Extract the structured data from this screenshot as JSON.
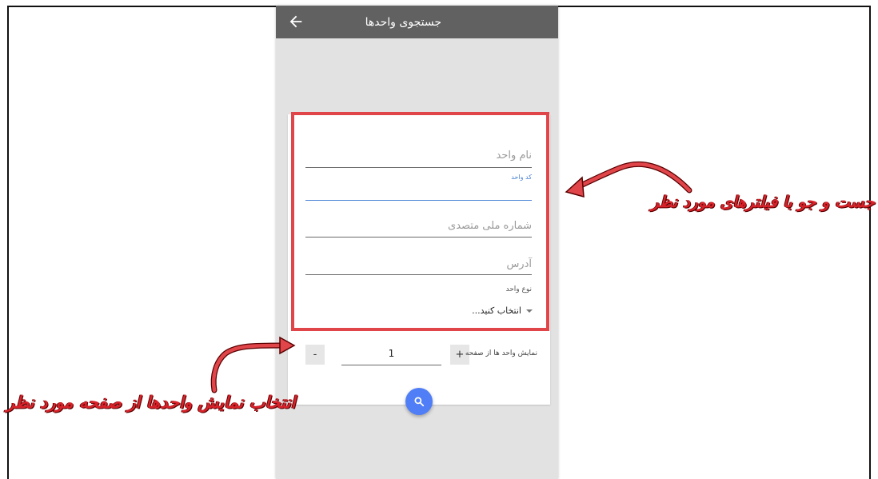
{
  "appbar": {
    "title": "جستجوی واحدها",
    "back_icon": "arrow-left-icon"
  },
  "form": {
    "unit_name_placeholder": "نام واحد",
    "unit_code_label": "کد واحد",
    "national_id_placeholder": "شماره ملی متصدی",
    "address_placeholder": "آدرس",
    "unit_type_label": "نوع واحد",
    "unit_type_selected": "انتخاب کنید..."
  },
  "pager": {
    "minus_label": "-",
    "plus_label": "+",
    "page_value": "1",
    "label": "نمایش واحد ها از صفحه"
  },
  "search_button": {
    "icon": "search-icon"
  },
  "annotations": {
    "filters_note": "جست و جو با فیلترهای مورد نظر",
    "paging_note": "انتخاب نمایش واحدها از صفحه مورد نظر"
  },
  "colors": {
    "appbar": "#616161",
    "highlight": "#e0454a",
    "fab": "#4f7ef6",
    "focus_label": "#4c84d6"
  }
}
